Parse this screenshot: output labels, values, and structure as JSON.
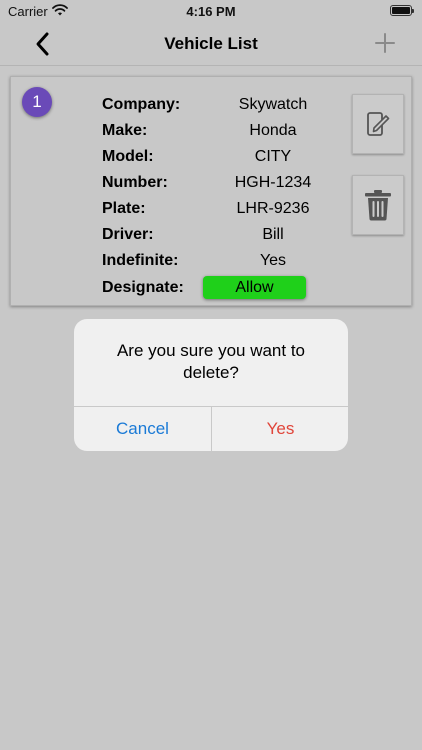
{
  "status_bar": {
    "carrier": "Carrier",
    "time": "4:16 PM"
  },
  "nav": {
    "title": "Vehicle List",
    "back_icon": "chevron-left-icon",
    "add_icon": "plus-icon"
  },
  "vehicle": {
    "index": "1",
    "fields": [
      {
        "label": "Company:",
        "value": "Skywatch"
      },
      {
        "label": "Make:",
        "value": "Honda"
      },
      {
        "label": "Model:",
        "value": "CITY"
      },
      {
        "label": "Number:",
        "value": "HGH-1234"
      },
      {
        "label": "Plate:",
        "value": "LHR-9236"
      },
      {
        "label": "Driver:",
        "value": "Bill"
      },
      {
        "label": "Indefinite:",
        "value": "Yes"
      }
    ],
    "designate": {
      "label": "Designate:",
      "value": "Allow",
      "color": "#1fd01a"
    },
    "edit_icon": "edit-icon",
    "delete_icon": "trash-icon"
  },
  "alert": {
    "message": "Are you sure you want to delete?",
    "cancel_label": "Cancel",
    "yes_label": "Yes",
    "cancel_color": "#1a7ad6",
    "yes_color": "#e0453a"
  },
  "colors": {
    "background": "#c8c8c8",
    "badge": "#6a4ab8"
  }
}
